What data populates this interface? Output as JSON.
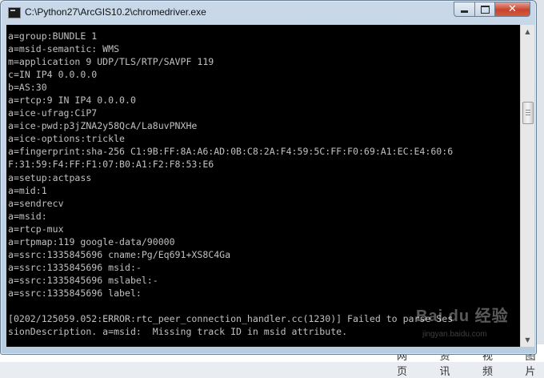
{
  "window": {
    "title": "C:\\Python27\\ArcGIS10.2\\chromedriver.exe",
    "close_glyph": "✕"
  },
  "console": {
    "lines": [
      "a=group:BUNDLE 1",
      "a=msid-semantic: WMS",
      "m=application 9 UDP/TLS/RTP/SAVPF 119",
      "c=IN IP4 0.0.0.0",
      "b=AS:30",
      "a=rtcp:9 IN IP4 0.0.0.0",
      "a=ice-ufrag:CiP7",
      "a=ice-pwd:p3jZNA2y58QcA/La8uvPNXHe",
      "a=ice-options:trickle",
      "a=fingerprint:sha-256 C1:9B:FF:8A:A6:AD:0B:C8:2A:F4:59:5C:FF:F0:69:A1:EC:E4:60:6",
      "F:31:59:F4:FF:F1:07:B0:A1:F2:F8:53:E6",
      "a=setup:actpass",
      "a=mid:1",
      "a=sendrecv",
      "a=msid:",
      "a=rtcp-mux",
      "a=rtpmap:119 google-data/90000",
      "a=ssrc:1335845696 cname:Pg/Eq691+XS8C4Ga",
      "a=ssrc:1335845696 msid:-",
      "a=ssrc:1335845696 mslabel:-",
      "a=ssrc:1335845696 label:",
      "",
      "[0202/125059.052:ERROR:rtc_peer_connection_handler.cc(1230)] Failed to parse Ses",
      "sionDescription. a=msid:  Missing track ID in msid attribute."
    ]
  },
  "background": {
    "tabs": [
      "网页",
      "资讯",
      "视频",
      "图片"
    ]
  },
  "watermark": {
    "logo": "Bai du 经验",
    "url": "jingyan.baidu.com"
  }
}
